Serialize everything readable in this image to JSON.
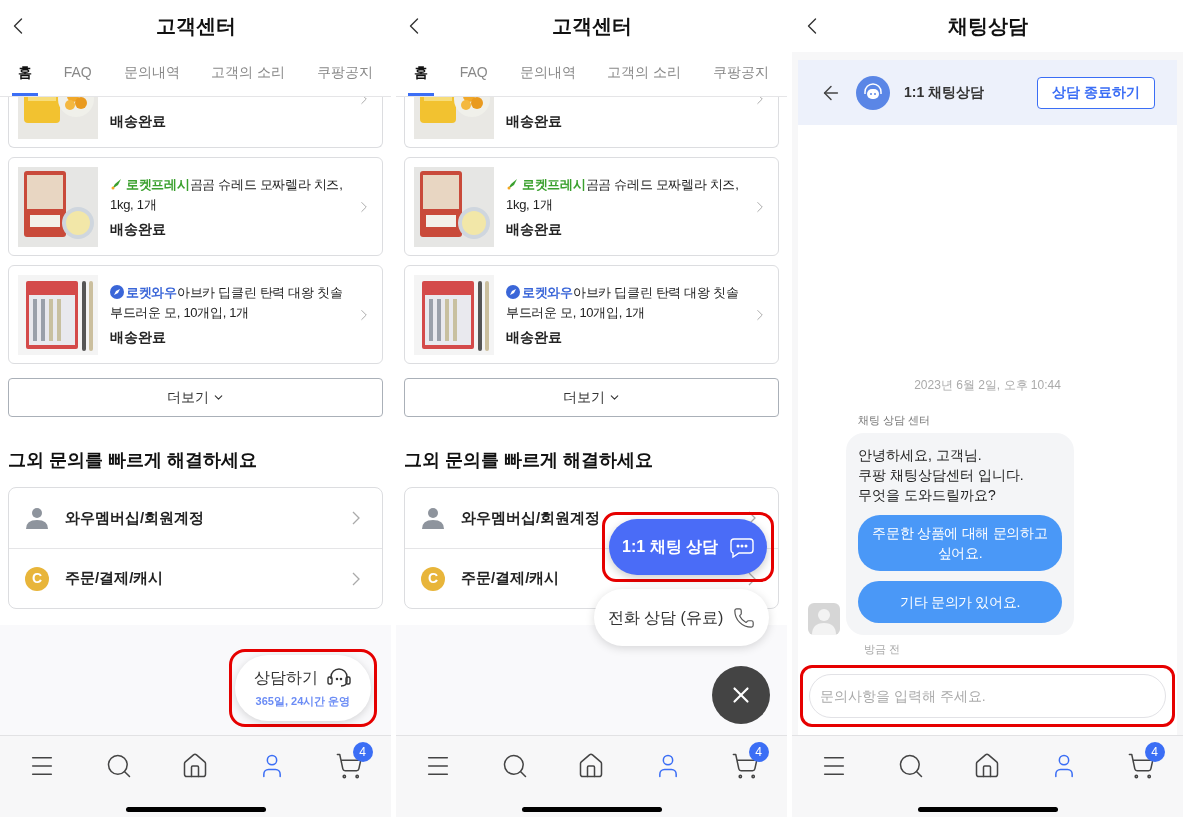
{
  "screens": [
    {
      "kind": "help",
      "title": "고객센터",
      "tabs": [
        {
          "label": "홈",
          "selected": true
        },
        {
          "label": "FAQ",
          "selected": false
        },
        {
          "label": "문의내역",
          "selected": false
        },
        {
          "label": "고객의 소리",
          "selected": false
        },
        {
          "label": "쿠팡공지",
          "selected": false
        }
      ],
      "orders": [
        {
          "kind": "status_only",
          "status": "배송완료"
        },
        {
          "kind": "fresh",
          "badge": "로켓프레시",
          "name": "곰곰 슈레드 모짜렐라 치즈, 1kg, 1개",
          "status": "배송완료"
        },
        {
          "kind": "wow",
          "badge": "로켓와우",
          "name": "아브카 딥클린 탄력 대왕 칫솔 부드러운 모, 10개입, 1개",
          "status": "배송완료"
        }
      ],
      "more_button": "더보기",
      "section_title": "그외 문의를 빠르게 해결하세요",
      "quick_links": [
        {
          "kind": "person",
          "label": "와우멤버십/회원계정"
        },
        {
          "kind": "coin",
          "icon_text": "C",
          "label": "주문/결제/캐시"
        }
      ],
      "fab": {
        "label": "상담하기",
        "sublabel": "365일, 24시간 운영",
        "highlighted": true
      },
      "nav": [
        {
          "kind": "menu",
          "selected": false
        },
        {
          "kind": "search",
          "selected": false
        },
        {
          "kind": "home",
          "selected": false
        },
        {
          "kind": "person",
          "selected": true
        },
        {
          "kind": "cart",
          "selected": false,
          "badge": "4"
        }
      ]
    },
    {
      "kind": "help",
      "title": "고객센터",
      "tabs": [
        {
          "label": "홈",
          "selected": true
        },
        {
          "label": "FAQ",
          "selected": false
        },
        {
          "label": "문의내역",
          "selected": false
        },
        {
          "label": "고객의 소리",
          "selected": false
        },
        {
          "label": "쿠팡공지",
          "selected": false
        }
      ],
      "orders": [
        {
          "kind": "status_only",
          "status": "배송완료"
        },
        {
          "kind": "fresh",
          "badge": "로켓프레시",
          "name": "곰곰 슈레드 모짜렐라 치즈, 1kg, 1개",
          "status": "배송완료"
        },
        {
          "kind": "wow",
          "badge": "로켓와우",
          "name": "아브카 딥클린 탄력 대왕 칫솔 부드러운 모, 10개입, 1개",
          "status": "배송완료"
        }
      ],
      "more_button": "더보기",
      "section_title": "그외 문의를 빠르게 해결하세요",
      "quick_links": [
        {
          "kind": "person",
          "label": "와우멤버십/회원계정"
        },
        {
          "kind": "coin",
          "icon_text": "C",
          "label": "주문/결제/캐시"
        }
      ],
      "contact_menu": {
        "options": [
          {
            "kind": "chat",
            "label": "1:1 채팅 상담",
            "highlighted": true
          },
          {
            "kind": "phone",
            "label": "전화 상담 (유료)",
            "highlighted": false
          }
        ]
      },
      "nav": [
        {
          "kind": "menu",
          "selected": false
        },
        {
          "kind": "search",
          "selected": false
        },
        {
          "kind": "home",
          "selected": false
        },
        {
          "kind": "person",
          "selected": true
        },
        {
          "kind": "cart",
          "selected": false,
          "badge": "4"
        }
      ]
    },
    {
      "kind": "chat",
      "title": "채팅상담",
      "chat_header": {
        "title": "1:1 채팅상담",
        "end_button": "상담 종료하기"
      },
      "date": "2023년 6월 2일, 오후 10:44",
      "sender": "채팅 상담 센터",
      "message": "안녕하세요, 고객님.\n쿠팡 채팅상담센터 입니다.\n무엇을 도와드릴까요?",
      "replies": [
        "주문한 상품에 대해 문의하고 싶어요.",
        "기타 문의가 있어요."
      ],
      "time": "방금 전",
      "input": {
        "placeholder": "문의사항을 입력해 주세요.",
        "highlighted": true
      },
      "nav": [
        {
          "kind": "menu",
          "selected": false
        },
        {
          "kind": "search",
          "selected": false
        },
        {
          "kind": "home",
          "selected": false
        },
        {
          "kind": "person",
          "selected": true
        },
        {
          "kind": "cart",
          "selected": false,
          "badge": "4"
        }
      ]
    }
  ]
}
